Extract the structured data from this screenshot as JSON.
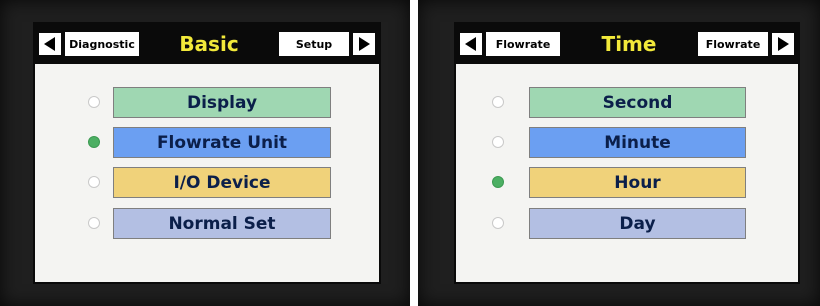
{
  "panels": [
    {
      "prev_tab": "Diagnostic",
      "title": "Basic",
      "next_tab": "Setup",
      "options": [
        {
          "label": "Display",
          "color": "#9fd7b2",
          "selected": false
        },
        {
          "label": "Flowrate Unit",
          "color": "#6b9ff2",
          "selected": true
        },
        {
          "label": "I/O Device",
          "color": "#f0d27a",
          "selected": false
        },
        {
          "label": "Normal Set",
          "color": "#b3bfe3",
          "selected": false
        }
      ]
    },
    {
      "prev_tab": "Flowrate",
      "title": "Time",
      "next_tab": "Flowrate",
      "options": [
        {
          "label": "Second",
          "color": "#9fd7b2",
          "selected": false
        },
        {
          "label": "Minute",
          "color": "#6b9ff2",
          "selected": false
        },
        {
          "label": "Hour",
          "color": "#f0d27a",
          "selected": true
        },
        {
          "label": "Day",
          "color": "#b3bfe3",
          "selected": false
        }
      ]
    }
  ],
  "icons": {
    "prev": "left-arrow-icon",
    "next": "right-arrow-icon",
    "radio": "radio-indicator-icon"
  },
  "colors": {
    "title": "#f2e93a",
    "header": "#0a0a0a",
    "radio_on": "#4caf63",
    "screen_bg": "#f4f4f2"
  }
}
